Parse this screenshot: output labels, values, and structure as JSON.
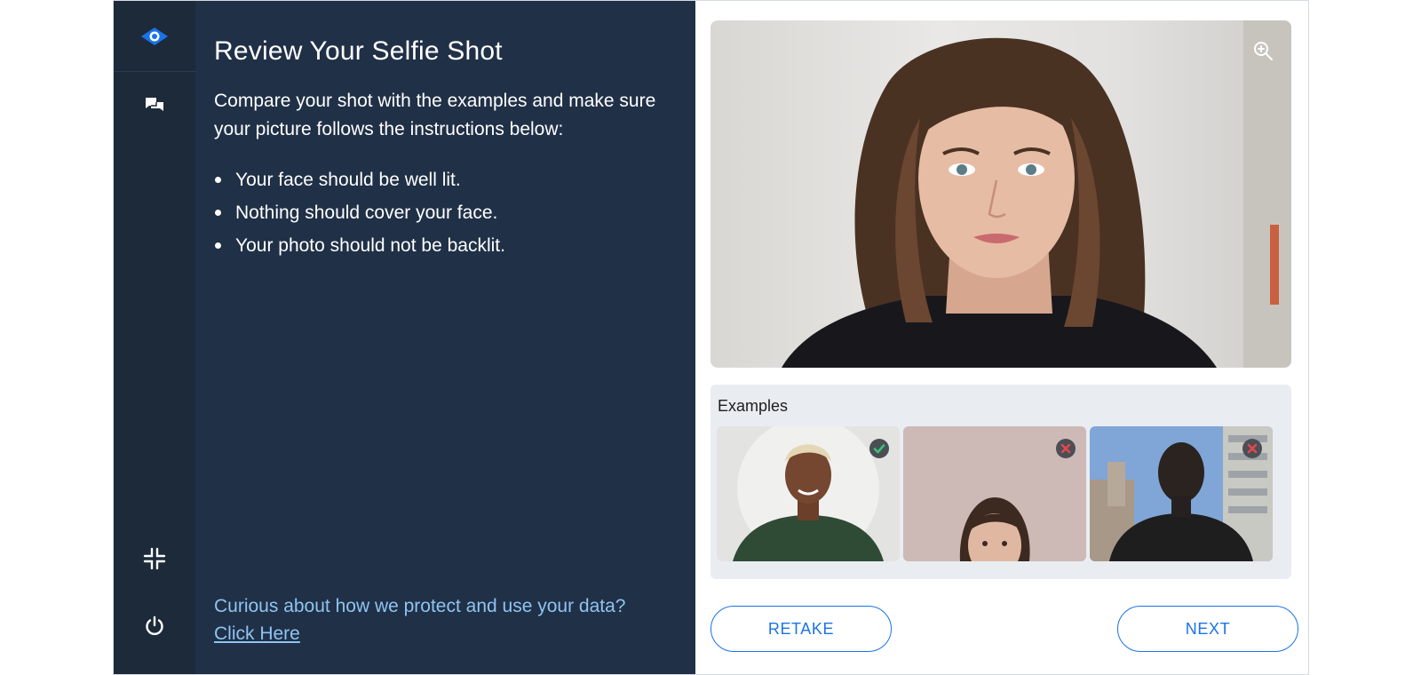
{
  "panel": {
    "title": "Review Your Selfie Shot",
    "intro": "Compare your shot with the examples and make sure your picture follows the instructions below:",
    "instructions": [
      "Your face should be well lit.",
      "Nothing should cover your face.",
      "Your photo should not be backlit."
    ],
    "privacy_text": "Curious about how we protect and use your data?",
    "privacy_link": "Click Here"
  },
  "rail": {
    "icons": [
      "eye-logo-icon",
      "chat-icon",
      "minimize-icon",
      "power-icon"
    ]
  },
  "examples": {
    "label": "Examples",
    "items": [
      {
        "status": "good",
        "icon": "check-icon"
      },
      {
        "status": "bad",
        "icon": "x-icon"
      },
      {
        "status": "bad",
        "icon": "x-icon"
      }
    ]
  },
  "buttons": {
    "retake": "RETAKE",
    "next": "NEXT"
  },
  "colors": {
    "rail": "#1c2a3a",
    "panel": "#203047",
    "accent": "#1a73e8",
    "link": "#8ec4f0",
    "good": "#3ec07a",
    "bad": "#e5474e"
  }
}
